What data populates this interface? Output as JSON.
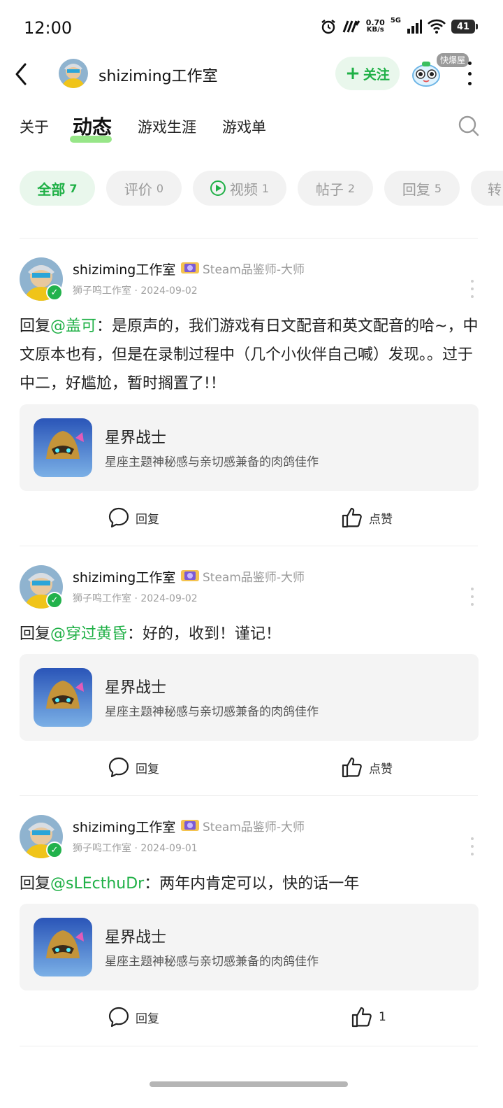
{
  "status_bar": {
    "time": "12:00",
    "speed_value": "0.70",
    "speed_unit": "KB/s",
    "network": "5G",
    "battery": "41"
  },
  "header": {
    "name": "shiziming工作室",
    "follow_label": "关注",
    "mascot_tag": "快爆屋"
  },
  "tabs": [
    {
      "label": "关于"
    },
    {
      "label": "动态"
    },
    {
      "label": "游戏生涯"
    },
    {
      "label": "游戏单"
    }
  ],
  "filters": [
    {
      "label": "全部",
      "count": "7"
    },
    {
      "label": "评价",
      "count": "0"
    },
    {
      "label": "视频",
      "count": "1"
    },
    {
      "label": "帖子",
      "count": "2"
    },
    {
      "label": "回复",
      "count": "5"
    },
    {
      "label": "转"
    }
  ],
  "posts": [
    {
      "author": "shiziming工作室",
      "title": "Steam品鉴师-大师",
      "sub": "狮子鸣工作室 · 2024-09-02",
      "reply_prefix": "回复",
      "mention": "@盖可",
      "text": "：是原声的，我们游戏有日文配音和英文配音的哈~，中文原本也有，但是在录制过程中（几个小伙伴自己喊）发现。。过于中二，好尴尬，暂时搁置了!！",
      "game_name": "星界战士",
      "game_desc": "星座主题神秘感与亲切感兼备的肉鸽佳作",
      "reply_label": "回复",
      "like_label": "点赞"
    },
    {
      "author": "shiziming工作室",
      "title": "Steam品鉴师-大师",
      "sub": "狮子鸣工作室 · 2024-09-02",
      "reply_prefix": "回复",
      "mention": "@穿过黄昏",
      "text": "：好的，收到！谨记！",
      "game_name": "星界战士",
      "game_desc": "星座主题神秘感与亲切感兼备的肉鸽佳作",
      "reply_label": "回复",
      "like_label": "点赞"
    },
    {
      "author": "shiziming工作室",
      "title": "Steam品鉴师-大师",
      "sub": "狮子鸣工作室 · 2024-09-01",
      "reply_prefix": "回复",
      "mention": "@sLEcthuDr",
      "text": "：两年内肯定可以，快的话一年",
      "game_name": "星界战士",
      "game_desc": "星座主题神秘感与亲切感兼备的肉鸽佳作",
      "reply_label": "回复",
      "like_label": "1"
    }
  ],
  "colors": {
    "accent_green": "#1fb046",
    "chip_bg": "#f2f2f2",
    "card_bg": "#f4f4f4"
  }
}
